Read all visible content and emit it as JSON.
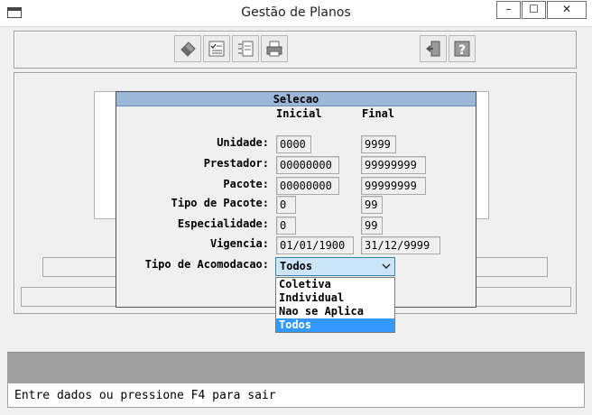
{
  "window": {
    "title": "Gestão de Planos",
    "minimize": "–",
    "maximize": "☐",
    "close": "✕"
  },
  "toolbar": {
    "icons": [
      "eraser-icon",
      "checklist-icon",
      "list-icon",
      "printer-icon",
      "exit-door-icon",
      "help-icon"
    ]
  },
  "dialog": {
    "title": "Selecao",
    "col_initial": "Inicial",
    "col_final": "Final",
    "rows": [
      {
        "label": "Unidade:",
        "initial": "0000",
        "final": "9999"
      },
      {
        "label": "Prestador:",
        "initial": "00000000",
        "final": "99999999"
      },
      {
        "label": "Pacote:",
        "initial": "00000000",
        "final": "99999999"
      },
      {
        "label": "Tipo de Pacote:",
        "initial": "0",
        "final": "99"
      },
      {
        "label": "Especialidade:",
        "initial": "0",
        "final": "99"
      },
      {
        "label": "Vigencia:",
        "initial": "01/01/1900",
        "final": "31/12/9999"
      }
    ],
    "acomodacao": {
      "label": "Tipo de Acomodacao:",
      "selected": "Todos",
      "options": [
        "Coletiva",
        "Individual",
        "Nao se Aplica",
        "Todos"
      ]
    }
  },
  "status": {
    "message": "Entre dados ou pressione F4 para sair"
  }
}
